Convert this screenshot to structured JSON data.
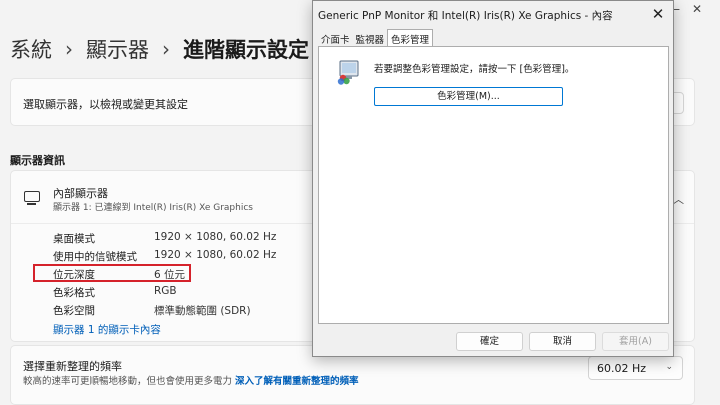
{
  "window_controls": {
    "minimize": "—",
    "close": "✕"
  },
  "breadcrumb": {
    "level1": "系統",
    "level2": "顯示器",
    "current": "進階顯示設定",
    "separator": "›"
  },
  "select_display": {
    "label": "選取顯示器，以檢視或變更其設定"
  },
  "display_info": {
    "section_title": "顯示器資訊",
    "monitor_name": "內部顯示器",
    "monitor_sub": "顯示器 1: 已連線到 Intel(R) Iris(R) Xe Graphics",
    "collapse_glyph": "︿",
    "rows": [
      {
        "key": "桌面模式",
        "value": "1920 × 1080, 60.02 Hz"
      },
      {
        "key": "使用中的信號模式",
        "value": "1920 × 1080, 60.02 Hz"
      },
      {
        "key": "位元深度",
        "value": "6 位元"
      },
      {
        "key": "色彩格式",
        "value": "RGB"
      },
      {
        "key": "色彩空間",
        "value": "標準動態範圍 (SDR)"
      }
    ],
    "adapter_link": "顯示器 1 的顯示卡內容"
  },
  "refresh": {
    "title": "選擇重新整理的頻率",
    "description": "較高的速率可更順暢地移動，但也會使用更多電力",
    "link": "深入了解有關重新整理的頻率",
    "value": "60.02 Hz",
    "chevron": "⌄"
  },
  "dialog": {
    "title": "Generic PnP Monitor 和 Intel(R) Iris(R) Xe Graphics - 內容",
    "close": "✕",
    "tabs": [
      "介面卡",
      "監視器",
      "色彩管理"
    ],
    "active_tab": "色彩管理",
    "instruction": "若要調整色彩管理設定，請按一下 [色彩管理]。",
    "color_mgmt_button": "色彩管理(M)...",
    "ok": "確定",
    "cancel": "取消",
    "apply": "套用(A)"
  },
  "colors": {
    "accent": "#005fb8",
    "highlight_box": "#d5222b",
    "dialog_button_focus": "#0078d4"
  }
}
